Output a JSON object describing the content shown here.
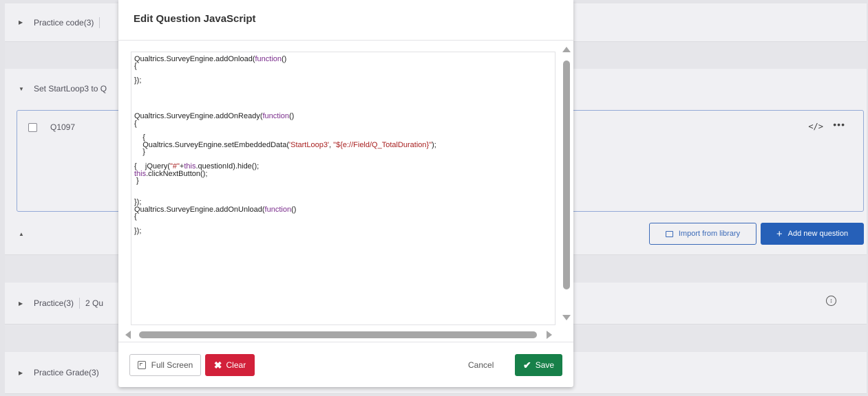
{
  "background": {
    "blocks": [
      {
        "title": "Practice code(3)",
        "expanded": false
      },
      {
        "title": "Set StartLoop3 to Q",
        "expanded": true
      },
      {
        "title": "Practice(3)",
        "subtitle": "2 Qu",
        "expanded": false
      },
      {
        "title": "Practice Grade(3)",
        "expanded": false
      }
    ],
    "question": {
      "id": "Q1097"
    },
    "import_button": "Import from library",
    "add_button": "Add new question"
  },
  "modal": {
    "title": "Edit Question JavaScript",
    "footer": {
      "full_screen": "Full Screen",
      "clear": "Clear",
      "cancel": "Cancel",
      "save": "Save"
    },
    "code_lines": [
      "Qualtrics.SurveyEngine.addOnload(function()",
      "{",
      "",
      "});",
      "",
      "",
      "",
      "",
      "Qualtrics.SurveyEngine.addOnReady(function()",
      "{",
      "",
      "    {",
      "    Qualtrics.SurveyEngine.setEmbeddedData('StartLoop3', \"${e://Field/Q_TotalDuration}\");",
      "    }",
      "",
      "{    jQuery(\"#\"+this.questionId).hide();",
      "this.clickNextButton();",
      " }",
      "",
      "",
      "});",
      "Qualtrics.SurveyEngine.addOnUnload(function()",
      "{",
      "",
      "});"
    ]
  },
  "colors": {
    "save": "#178049",
    "clear": "#d2213a",
    "primary": "#2660b8",
    "keyword": "#7a2d8c",
    "string": "#a82020"
  }
}
